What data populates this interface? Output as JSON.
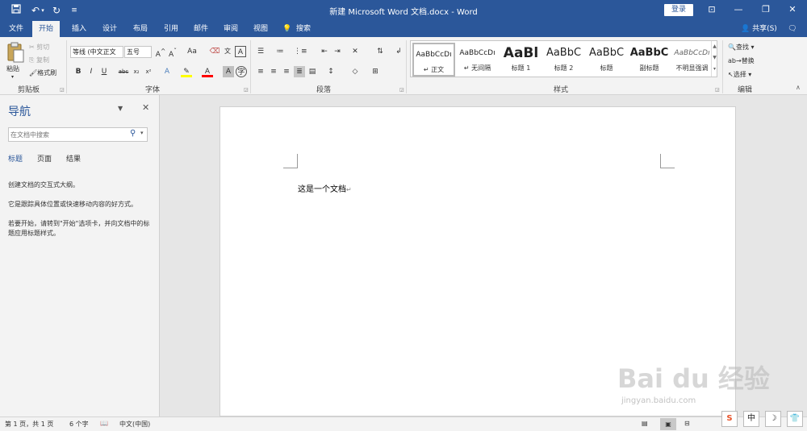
{
  "app": {
    "title": "新建 Microsoft Word 文档.docx - Word",
    "login_label": "登录",
    "quick_access": [
      "save-icon",
      "undo-icon",
      "redo-icon",
      "customize-icon"
    ]
  },
  "tabs": [
    {
      "label": "文件"
    },
    {
      "label": "开始",
      "active": true
    },
    {
      "label": "插入"
    },
    {
      "label": "设计"
    },
    {
      "label": "布局"
    },
    {
      "label": "引用"
    },
    {
      "label": "邮件"
    },
    {
      "label": "审阅"
    },
    {
      "label": "视图"
    }
  ],
  "search_tab": "搜索",
  "share_label": "共享(S)",
  "ribbon": {
    "clipboard": {
      "group": "剪贴板",
      "paste": "粘贴",
      "cut": "剪切",
      "copy": "复制",
      "format_painter": "格式刷"
    },
    "font": {
      "group": "字体",
      "font_name": "等线 (中文正文",
      "font_size": "五号",
      "case_button": "Aa",
      "wen": "文"
    },
    "paragraph": {
      "group": "段落"
    },
    "styles": {
      "group": "样式",
      "items": [
        {
          "sample": "AaBbCcDı",
          "name": "正文"
        },
        {
          "sample": "AaBbCcDı",
          "name": "无间隔"
        },
        {
          "sample": "AaBl",
          "name": "标题 1"
        },
        {
          "sample": "AaBbC",
          "name": "标题 2"
        },
        {
          "sample": "AaBbC",
          "name": "标题"
        },
        {
          "sample": "AaBbC",
          "name": "副标题"
        },
        {
          "sample": "AaBbCcDı",
          "name": "不明显强调"
        }
      ]
    },
    "editing": {
      "group": "编辑",
      "find": "查找",
      "replace": "替换",
      "select": "选择"
    }
  },
  "nav": {
    "title": "导航",
    "search_placeholder": "在文档中搜索",
    "tabs": [
      "标题",
      "页面",
      "结果"
    ],
    "text1": "创建文档的交互式大纲。",
    "text2": "它是跟踪具体位置或快速移动内容的好方式。",
    "text3": "若要开始，请转到\"开始\"选项卡，并向文档中的标题应用标题样式。"
  },
  "document": {
    "text": "这是一个文档"
  },
  "status": {
    "page": "第 1 页，共 1 页",
    "words": "6 个字",
    "language": "中文(中国)"
  },
  "ime": [
    "S",
    "中",
    "☽",
    "👕"
  ],
  "watermark": {
    "main": "Bai du 经验",
    "sub": "jingyan.baidu.com"
  }
}
